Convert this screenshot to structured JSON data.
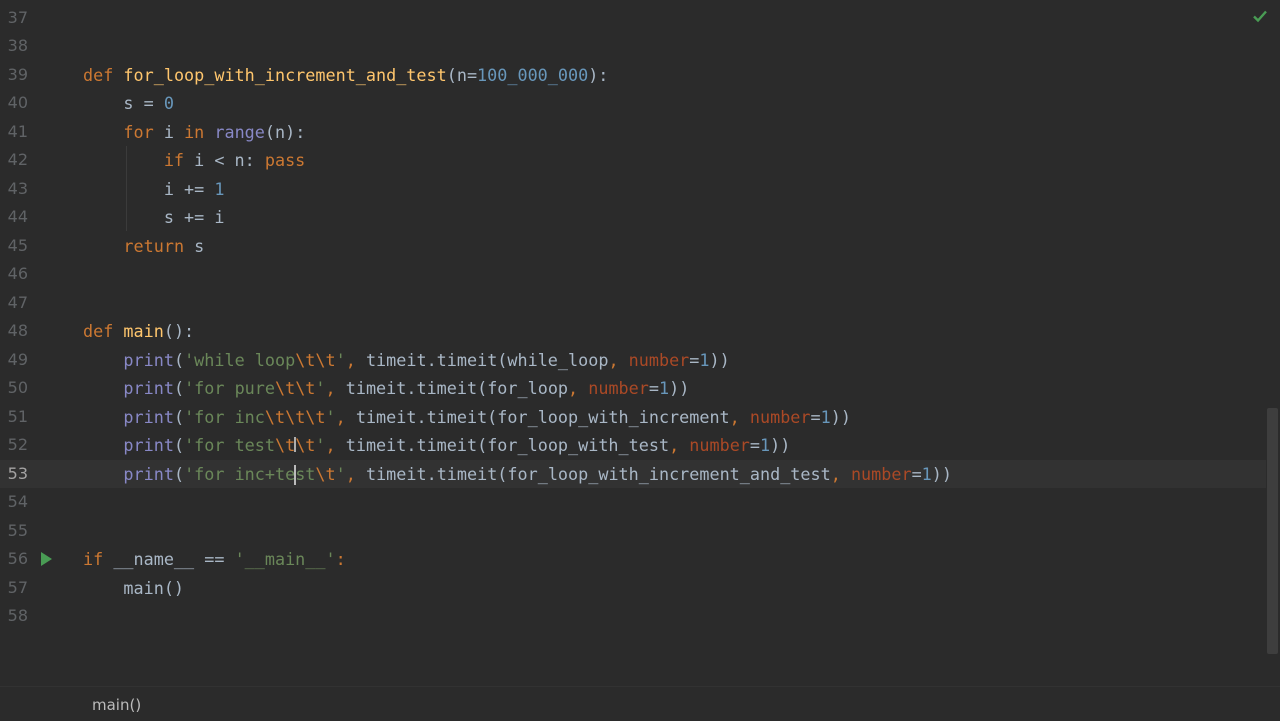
{
  "editor": {
    "lines": [
      {
        "n": "37",
        "tokens": []
      },
      {
        "n": "38",
        "tokens": []
      },
      {
        "n": "39",
        "tokens": [
          [
            "kw",
            "def "
          ],
          [
            "fn",
            "for_loop_with_increment_and_test"
          ],
          [
            "",
            "(n="
          ],
          [
            "num",
            "100_000_000"
          ],
          [
            "",
            "):"
          ]
        ]
      },
      {
        "n": "40",
        "tokens": [
          [
            "",
            "    s = "
          ],
          [
            "num",
            "0"
          ]
        ]
      },
      {
        "n": "41",
        "tokens": [
          [
            "",
            "    "
          ],
          [
            "kw",
            "for "
          ],
          [
            "",
            "i "
          ],
          [
            "kw",
            "in "
          ],
          [
            "bi",
            "range"
          ],
          [
            "",
            "(n):"
          ]
        ]
      },
      {
        "n": "42",
        "tokens": [
          [
            "",
            "        "
          ],
          [
            "kw",
            "if "
          ],
          [
            "",
            "i < n: "
          ],
          [
            "kw",
            "pass"
          ]
        ]
      },
      {
        "n": "43",
        "tokens": [
          [
            "",
            "        i += "
          ],
          [
            "num",
            "1"
          ]
        ]
      },
      {
        "n": "44",
        "tokens": [
          [
            "",
            "        s += i"
          ]
        ]
      },
      {
        "n": "45",
        "tokens": [
          [
            "",
            "    "
          ],
          [
            "kw",
            "return "
          ],
          [
            "",
            "s"
          ]
        ]
      },
      {
        "n": "46",
        "tokens": []
      },
      {
        "n": "47",
        "tokens": []
      },
      {
        "n": "48",
        "tokens": [
          [
            "kw",
            "def "
          ],
          [
            "fn",
            "main"
          ],
          [
            "",
            "():"
          ]
        ]
      },
      {
        "n": "49",
        "tokens": [
          [
            "",
            "    "
          ],
          [
            "bi",
            "print"
          ],
          [
            "",
            "("
          ],
          [
            "str",
            "'while loop"
          ],
          [
            "esc",
            "\\t\\t"
          ],
          [
            "str",
            "'"
          ],
          [
            "kw",
            ", "
          ],
          [
            "",
            "timeit.timeit(while_loop"
          ],
          [
            "kw",
            ", "
          ],
          [
            "param",
            "number"
          ],
          [
            "",
            "="
          ],
          [
            "num",
            "1"
          ],
          [
            "",
            "))"
          ]
        ]
      },
      {
        "n": "50",
        "tokens": [
          [
            "",
            "    "
          ],
          [
            "bi",
            "print"
          ],
          [
            "",
            "("
          ],
          [
            "str",
            "'for pure"
          ],
          [
            "esc",
            "\\t\\t"
          ],
          [
            "str",
            "'"
          ],
          [
            "kw",
            ", "
          ],
          [
            "",
            "timeit.timeit(for_loop"
          ],
          [
            "kw",
            ", "
          ],
          [
            "param",
            "number"
          ],
          [
            "",
            "="
          ],
          [
            "num",
            "1"
          ],
          [
            "",
            "))"
          ]
        ]
      },
      {
        "n": "51",
        "tokens": [
          [
            "",
            "    "
          ],
          [
            "bi",
            "print"
          ],
          [
            "",
            "("
          ],
          [
            "str",
            "'for inc"
          ],
          [
            "esc",
            "\\t\\t\\t"
          ],
          [
            "str",
            "'"
          ],
          [
            "kw",
            ", "
          ],
          [
            "",
            "timeit.timeit(for_loop_with_increment"
          ],
          [
            "kw",
            ", "
          ],
          [
            "param",
            "number"
          ],
          [
            "",
            "="
          ],
          [
            "num",
            "1"
          ],
          [
            "",
            "))"
          ]
        ]
      },
      {
        "n": "52",
        "tokens": [
          [
            "",
            "    "
          ],
          [
            "bi",
            "print"
          ],
          [
            "",
            "("
          ],
          [
            "str",
            "'for test"
          ],
          [
            "esc",
            "\\t\\t"
          ],
          [
            "str",
            "'"
          ],
          [
            "kw",
            ", "
          ],
          [
            "",
            "timeit.timeit(for_loop_with_test"
          ],
          [
            "kw",
            ", "
          ],
          [
            "param",
            "number"
          ],
          [
            "",
            "="
          ],
          [
            "num",
            "1"
          ],
          [
            "",
            "))"
          ]
        ]
      },
      {
        "n": "53",
        "tokens": [
          [
            "",
            "    "
          ],
          [
            "bi",
            "print"
          ],
          [
            "",
            "("
          ],
          [
            "str",
            "'for inc+te"
          ],
          [
            "caret",
            ""
          ],
          [
            "str",
            "st"
          ],
          [
            "esc",
            "\\t"
          ],
          [
            "str",
            "'"
          ],
          [
            "kw",
            ", "
          ],
          [
            "",
            "timeit.timeit(for_loop_with_increment_and_test"
          ],
          [
            "kw",
            ", "
          ],
          [
            "param",
            "number"
          ],
          [
            "",
            "="
          ],
          [
            "num",
            "1"
          ],
          [
            "",
            "))"
          ]
        ]
      },
      {
        "n": "54",
        "tokens": []
      },
      {
        "n": "55",
        "tokens": []
      },
      {
        "n": "56",
        "tokens": [
          [
            "kw",
            "if "
          ],
          [
            "",
            "__name__ == "
          ],
          [
            "str",
            "'__main__'"
          ],
          [
            "kw",
            ":"
          ]
        ],
        "run": true
      },
      {
        "n": "57",
        "tokens": [
          [
            "",
            "    main()"
          ]
        ]
      },
      {
        "n": "58",
        "tokens": []
      }
    ],
    "current_line": "53"
  },
  "breadcrumb": {
    "label": "main()"
  },
  "colors": {
    "background": "#2b2b2b",
    "keyword": "#cc7832",
    "function": "#ffc66d",
    "number": "#6897bb",
    "string": "#6a8759",
    "param": "#aa4926",
    "text": "#a9b7c6"
  },
  "icons": {
    "inspection_status": "check-icon",
    "run_gutter": "run-icon"
  }
}
